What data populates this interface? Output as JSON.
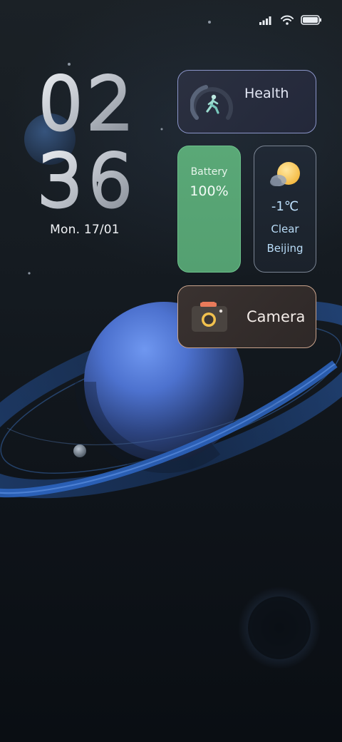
{
  "status_bar": {
    "signal_icon": "signal-bars-icon",
    "wifi_icon": "wifi-icon",
    "battery_icon": "battery-full-icon"
  },
  "clock": {
    "hours": "02",
    "minutes": "36",
    "date": "Mon. 17/01"
  },
  "widgets": {
    "health": {
      "label": "Health",
      "icon": "walking-figure-icon"
    },
    "battery": {
      "title": "Battery",
      "value": "100%",
      "level": 1.0
    },
    "weather": {
      "temperature": "-1℃",
      "condition": "Clear",
      "city": "Beijing",
      "icon": "sun-behind-cloud-icon"
    },
    "camera": {
      "label": "Camera",
      "icon": "camera-icon"
    }
  },
  "colors": {
    "battery_widget": "#58a474",
    "health_border": "#8b95c9",
    "camera_border": "#c9a38c",
    "planet_blue": "#6b8fe8"
  }
}
